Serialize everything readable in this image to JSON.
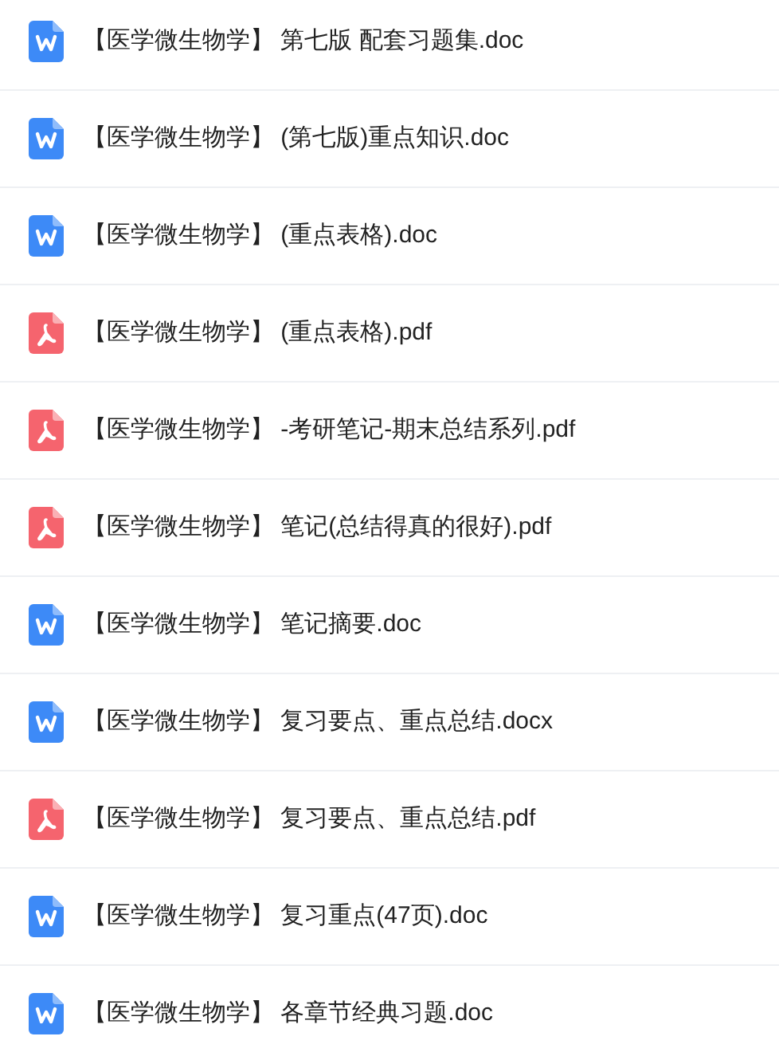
{
  "files": [
    {
      "kind": "doc",
      "name": "【医学微生物学】 第七版 配套习题集.doc"
    },
    {
      "kind": "doc",
      "name": "【医学微生物学】 (第七版)重点知识.doc"
    },
    {
      "kind": "doc",
      "name": "【医学微生物学】 (重点表格).doc"
    },
    {
      "kind": "pdf",
      "name": "【医学微生物学】 (重点表格).pdf"
    },
    {
      "kind": "pdf",
      "name": "【医学微生物学】 -考研笔记-期末总结系列.pdf"
    },
    {
      "kind": "pdf",
      "name": "【医学微生物学】 笔记(总结得真的很好).pdf"
    },
    {
      "kind": "doc",
      "name": "【医学微生物学】 笔记摘要.doc"
    },
    {
      "kind": "doc",
      "name": "【医学微生物学】 复习要点、重点总结.docx"
    },
    {
      "kind": "pdf",
      "name": "【医学微生物学】 复习要点、重点总结.pdf"
    },
    {
      "kind": "doc",
      "name": "【医学微生物学】 复习重点(47页).doc"
    },
    {
      "kind": "doc",
      "name": "【医学微生物学】 各章节经典习题.doc"
    }
  ]
}
